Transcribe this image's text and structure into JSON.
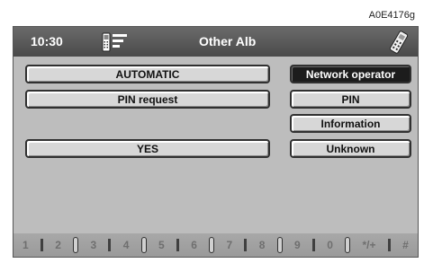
{
  "reference_code": "A0E4176g",
  "header": {
    "time": "10:30",
    "title": "Other Alb"
  },
  "left_column": {
    "mode": "AUTOMATIC",
    "pin_request": "PIN request",
    "value": "YES"
  },
  "right_column": {
    "network_operator": "Network operator",
    "pin": "PIN",
    "information": "Information",
    "unknown": "Unknown"
  },
  "keypad": [
    "1",
    "2",
    "3",
    "4",
    "5",
    "6",
    "7",
    "8",
    "9",
    "0",
    "*/+",
    "#"
  ],
  "icons": {
    "status": "phone-signal-icon",
    "handset": "mobile-phone-icon"
  }
}
